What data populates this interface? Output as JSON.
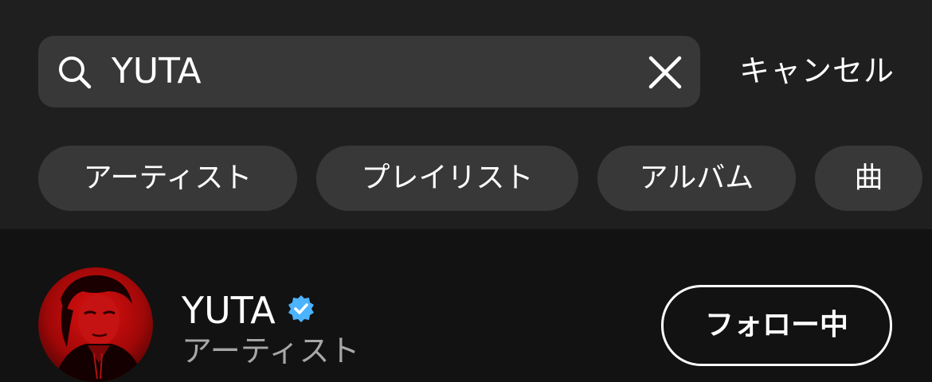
{
  "search": {
    "value": "YUTA",
    "cancel_label": "キャンセル",
    "search_icon": "search-icon",
    "clear_icon": "close-icon"
  },
  "filters": [
    {
      "label": "アーティスト"
    },
    {
      "label": "プレイリスト"
    },
    {
      "label": "アルバム"
    },
    {
      "label": "曲"
    }
  ],
  "results": [
    {
      "title": "YUTA",
      "subtitle": "アーティスト",
      "verified": true,
      "follow_label": "フォロー中"
    }
  ],
  "colors": {
    "background": "#121212",
    "header_background": "#1f1f1f",
    "surface": "#383838",
    "text_primary": "#ffffff",
    "text_secondary": "#a7a7a7",
    "verified_blue": "#4cb3ff"
  }
}
